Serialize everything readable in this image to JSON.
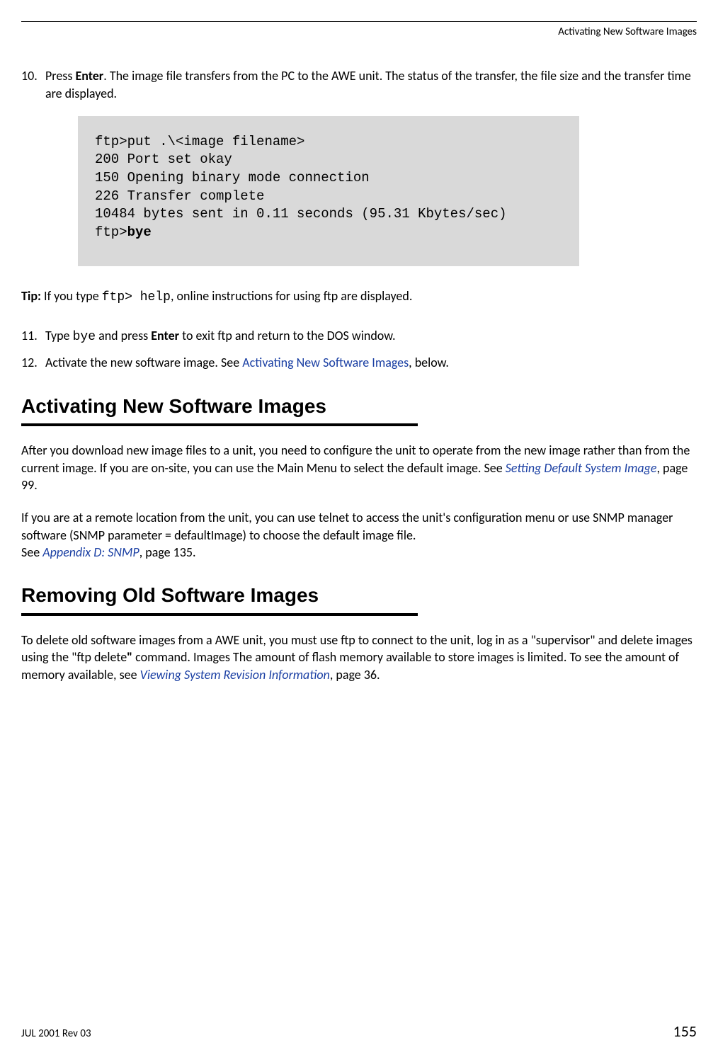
{
  "header": {
    "section_title": "Activating New Software Images"
  },
  "step10": {
    "num": "10.",
    "t1": "Press ",
    "enter": "Enter",
    "t2": ". The image file transfers from the PC to the  AWE unit. The status of the transfer, the file size and the transfer time are displayed."
  },
  "code": {
    "l1": "ftp>put .\\<image filename>",
    "l2": "200 Port set okay",
    "l3": "150 Opening binary mode connection",
    "l4": "226 Transfer complete",
    "l5": "10484 bytes sent in 0.11 seconds (95.31 Kbytes/sec)",
    "l6a": "ftp>",
    "l6b": "bye"
  },
  "tip": {
    "label": "Tip: ",
    "t1": "If you type ",
    "cmd": "ftp> help",
    "t2": ", online instructions for using ftp are displayed."
  },
  "step11": {
    "num": "11.",
    "t1": "Type ",
    "bye": "bye",
    "t2": " and press ",
    "enter": "Enter",
    "t3": " to exit ftp and return to the DOS window."
  },
  "step12": {
    "num": "12.",
    "t1": "Activate the new software image. See ",
    "link": "Activating New Software Images",
    "t2": ", below."
  },
  "h2a": {
    "title": "Activating New Software Images"
  },
  "para1": {
    "t1": "After you download new image files to a unit, you need to configure the unit to operate from the new image rather than from the current image. If you are on-site, you can use the Main Menu to select the default image. See ",
    "link": "Setting Default System Image",
    "t2": ", page 99."
  },
  "para2": {
    "t1": "If you are at a remote location from the unit, you can use telnet to access the unit's configuration menu or use SNMP manager software (SNMP parameter = defaultImage) to choose the default image file.",
    "t2": "See ",
    "link": "Appendix D: SNMP",
    "t3": ", page 135."
  },
  "h2b": {
    "title": "Removing Old Software Images"
  },
  "para3": {
    "t1": "To delete old software images from a  AWE unit, you must use ftp to connect to the unit, log in as a \"supervisor\" and delete images using the \"ftp delete",
    "q": "\"",
    "t2": " command. Images The amount of flash memory available to store images is limited. To see the amount of memory available, see ",
    "link": "Viewing System Revision Information",
    "t3": ", page 36."
  },
  "footer": {
    "date": "JUL 2001 Rev 03",
    "page": "155"
  }
}
